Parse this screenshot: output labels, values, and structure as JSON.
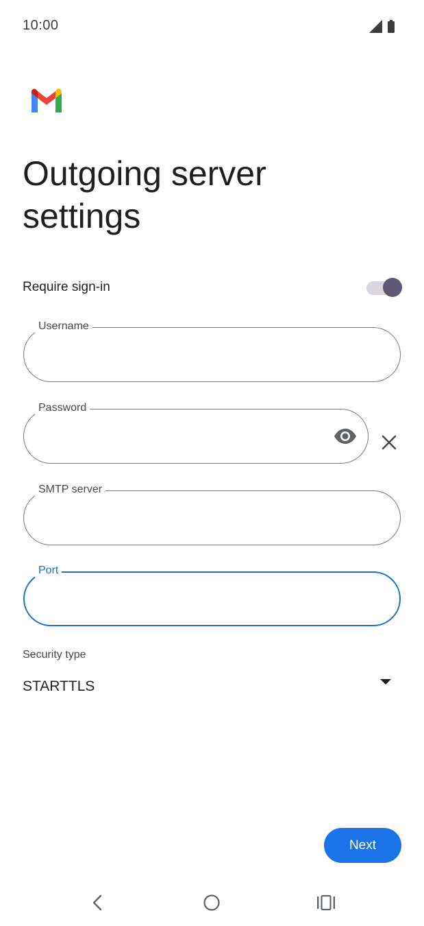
{
  "status_bar": {
    "time": "10:00",
    "icons": [
      "signal-icon",
      "battery-icon"
    ]
  },
  "app": {
    "logo": "gmail-logo-icon"
  },
  "title": "Outgoing server settings",
  "require_signin": {
    "label": "Require sign-in",
    "enabled": true
  },
  "fields": {
    "username": {
      "label": "Username",
      "value": ""
    },
    "password": {
      "label": "Password",
      "value": ""
    },
    "smtp": {
      "label": "SMTP server",
      "value": ""
    },
    "port": {
      "label": "Port",
      "value": "",
      "focused": true
    }
  },
  "security": {
    "label": "Security type",
    "value": "STARTTLS"
  },
  "actions": {
    "next_label": "Next"
  },
  "nav_bar": {
    "icons": [
      "back-icon",
      "home-icon",
      "recents-icon"
    ]
  },
  "colors": {
    "accent": "#1b73e8",
    "focus": "#1a6fd1",
    "switch_thumb": "#5e5873"
  }
}
